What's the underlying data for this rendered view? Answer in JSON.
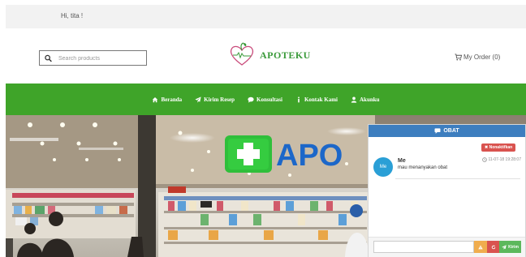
{
  "topbar": {
    "greeting": "Hi, tita !"
  },
  "header": {
    "search_placeholder": "Search products",
    "logo_text": "APOTEKU",
    "cart_label": "My Order (0)"
  },
  "nav": {
    "items": [
      {
        "label": "Beranda",
        "icon": "home-icon"
      },
      {
        "label": "Kirim Resep",
        "icon": "send-icon"
      },
      {
        "label": "Konsultasi",
        "icon": "chat-bubble-icon"
      },
      {
        "label": "Kontak Kami",
        "icon": "info-icon"
      },
      {
        "label": "Akunku",
        "icon": "user-icon"
      }
    ]
  },
  "hero": {
    "sign_text": "APO"
  },
  "chat": {
    "title": "OBAT",
    "nonaktif_label": "✖ Nonaktifkan",
    "message": {
      "avatar": "Me",
      "sender": "Me",
      "time": "11-07-18 19:28:07",
      "text": "mau menanyakan obat"
    },
    "send_label": "Kirim"
  },
  "colors": {
    "nav_green": "#3fa429",
    "chat_header": "#3d7ebf",
    "danger": "#d9534f",
    "warning": "#f0ad4e",
    "success": "#5cb85c",
    "logo_green": "#3a9a3a"
  }
}
